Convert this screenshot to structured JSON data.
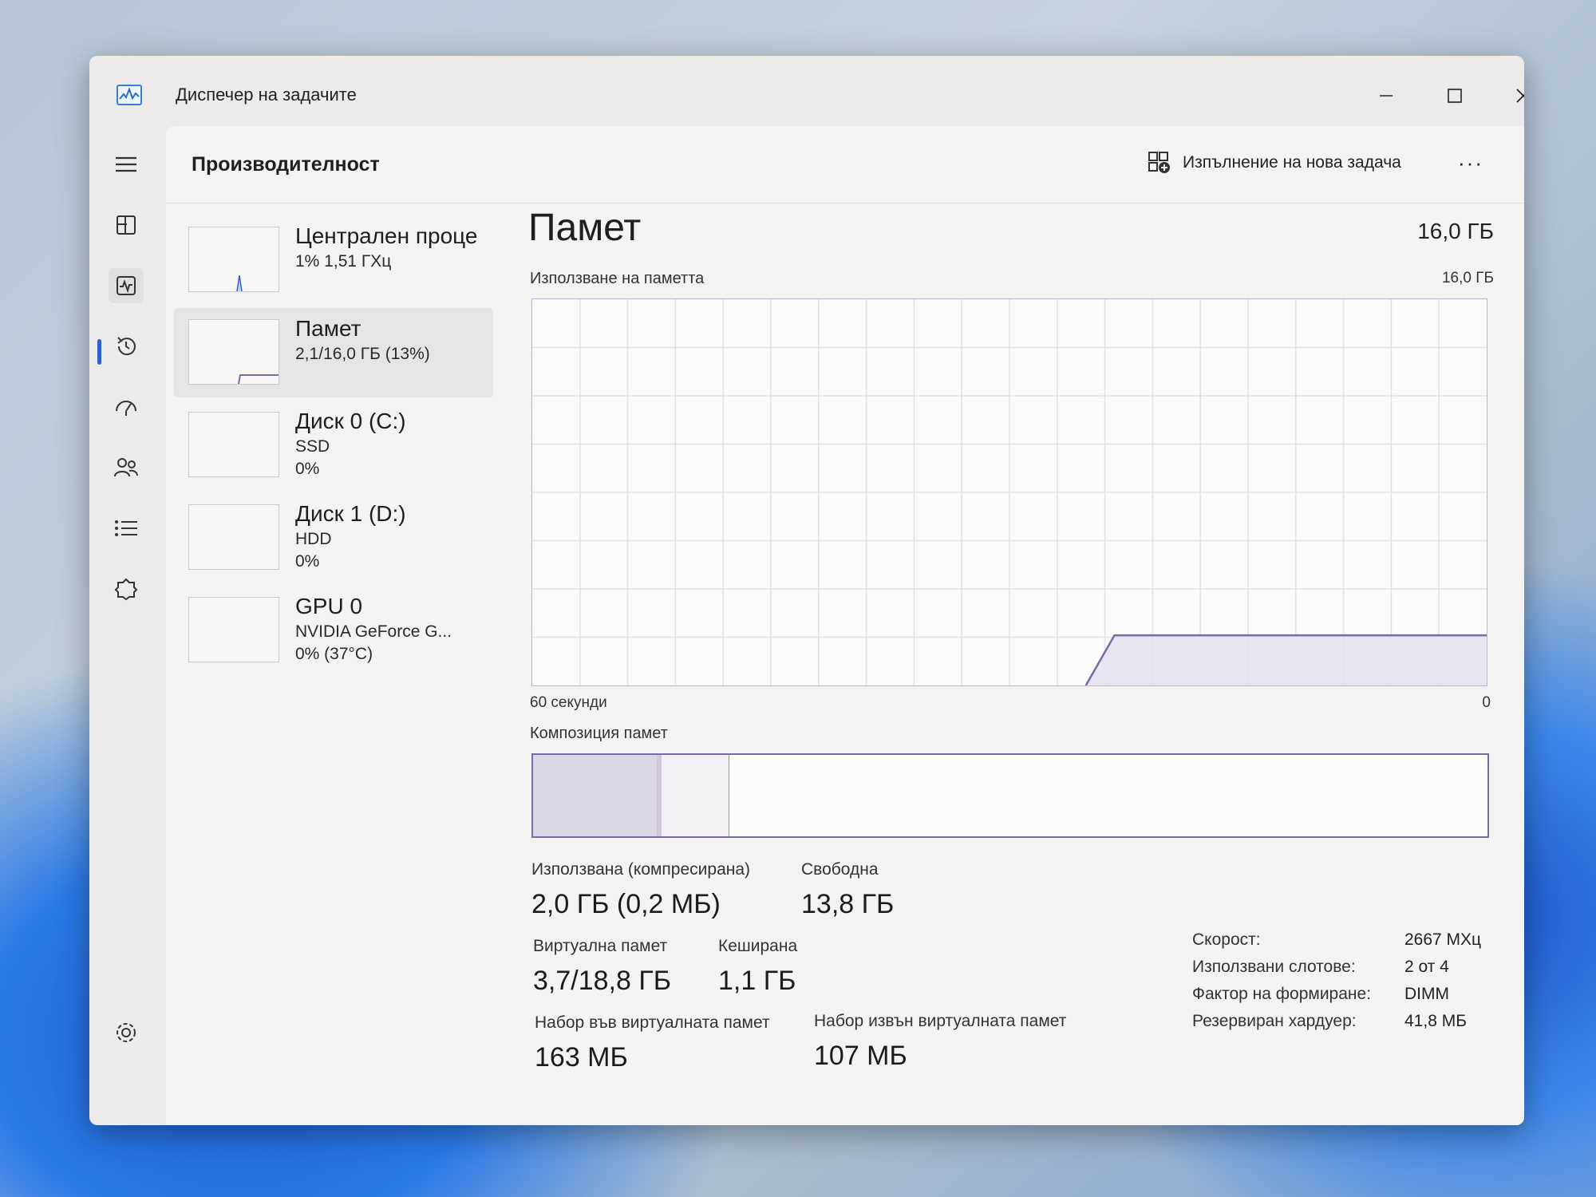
{
  "window": {
    "title": "Диспечер на задачите"
  },
  "header": {
    "title": "Производителност",
    "run_task_label": "Изпълнение на нова задача",
    "more_label": "···"
  },
  "nav": [
    {
      "name": "hamburger-menu-icon"
    },
    {
      "name": "processes-icon"
    },
    {
      "name": "performance-icon",
      "active": true
    },
    {
      "name": "app-history-icon"
    },
    {
      "name": "startup-apps-icon"
    },
    {
      "name": "users-icon"
    },
    {
      "name": "details-icon"
    },
    {
      "name": "services-icon"
    },
    {
      "name": "settings-icon"
    }
  ],
  "devices": [
    {
      "name": "Централен проце",
      "line1": "1% 1,51 ГХц",
      "line2": ""
    },
    {
      "name": "Памет",
      "line1": "2,1/16,0 ГБ (13%)",
      "line2": ""
    },
    {
      "name": "Диск 0 (C:)",
      "line1": "SSD",
      "line2": "0%"
    },
    {
      "name": "Диск 1 (D:)",
      "line1": "HDD",
      "line2": "0%"
    },
    {
      "name": "GPU 0",
      "line1": "NVIDIA GeForce G...",
      "line2": "0% (37°C)"
    }
  ],
  "memory": {
    "title": "Памет",
    "capacity": "16,0 ГБ",
    "usage_label": "Използване на паметта",
    "usage_max": "16,0 ГБ",
    "x_left": "60 секунди",
    "x_right": "0",
    "usage_fraction": 0.13,
    "composition_label": "Композиция памет",
    "composition": {
      "in_use_fraction": 0.13,
      "modified_fraction": 0.005,
      "standby_fraction": 0.07
    },
    "stats": [
      {
        "label": "Използвана (компресирана)",
        "value": "2,0 ГБ (0,2 МБ)"
      },
      {
        "label": "Свободна",
        "value": "13,8 ГБ"
      },
      {
        "label": "Виртуална памет",
        "value": "3,7/18,8 ГБ"
      },
      {
        "label": "Кеширана",
        "value": "1,1 ГБ"
      },
      {
        "label": "Набор във виртуалната памет",
        "value": "163 МБ"
      },
      {
        "label": "Набор извън виртуалната памет",
        "value": "107 МБ"
      }
    ],
    "specs": [
      {
        "label": "Скорост:",
        "value": "2667 МХц"
      },
      {
        "label": "Използвани слотове:",
        "value": "2 от 4"
      },
      {
        "label": "Фактор на формиране:",
        "value": "DIMM"
      },
      {
        "label": "Резервиран хардуер:",
        "value": "41,8 МБ"
      }
    ]
  },
  "colors": {
    "accent": "#2d5fd3",
    "memory": "#7a6aa8"
  }
}
